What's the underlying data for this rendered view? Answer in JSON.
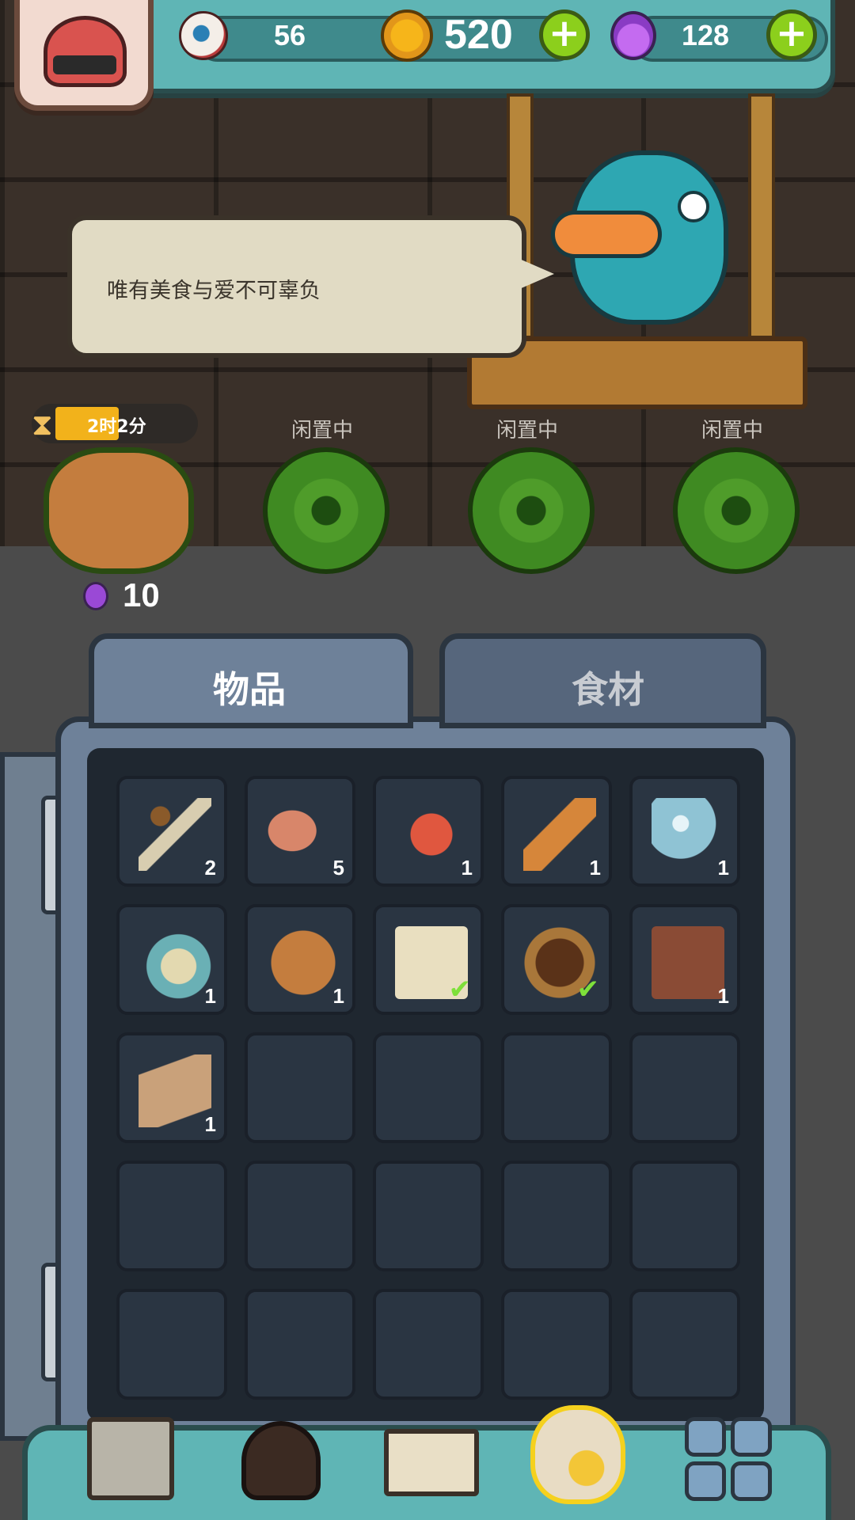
{
  "top_bar": {
    "eyeball_count": "56",
    "gold_count": "520",
    "potion_count": "128",
    "colors": {
      "bar": "#5fb5b5",
      "plus": "#8ccf1c"
    }
  },
  "speech_bubble": {
    "text": "唯有美食与爱不可辜负"
  },
  "production": {
    "timer_text": "2时2分",
    "cost": "10",
    "idle_label": "闲置中"
  },
  "tabs": [
    {
      "label": "物品"
    },
    {
      "label": "食材"
    }
  ],
  "inventory": {
    "cells": [
      {
        "icon": "rope-icon",
        "count": "2",
        "checked": false
      },
      {
        "icon": "club-icon",
        "count": "5",
        "checked": false
      },
      {
        "icon": "spiky-skull-icon",
        "count": "1",
        "checked": false
      },
      {
        "icon": "feather-icon",
        "count": "1",
        "checked": false
      },
      {
        "icon": "crystal-ball-icon",
        "count": "1",
        "checked": false
      },
      {
        "icon": "snail-monster-icon",
        "count": "1",
        "checked": false
      },
      {
        "icon": "stump-monster-icon",
        "count": "1",
        "checked": false
      },
      {
        "icon": "scroll-icon",
        "count": "",
        "checked": true
      },
      {
        "icon": "rune-tablet-icon",
        "count": "",
        "checked": true
      },
      {
        "icon": "book-icon",
        "count": "1",
        "checked": false
      },
      {
        "icon": "map-icon",
        "count": "1",
        "checked": false
      }
    ],
    "total_slots": 25
  },
  "nav": [
    {
      "icon": "shop-building-icon"
    },
    {
      "icon": "torch-monster-icon"
    },
    {
      "icon": "recipe-book-icon"
    },
    {
      "icon": "bag-icon"
    },
    {
      "icon": "grid-menu-icon"
    }
  ]
}
